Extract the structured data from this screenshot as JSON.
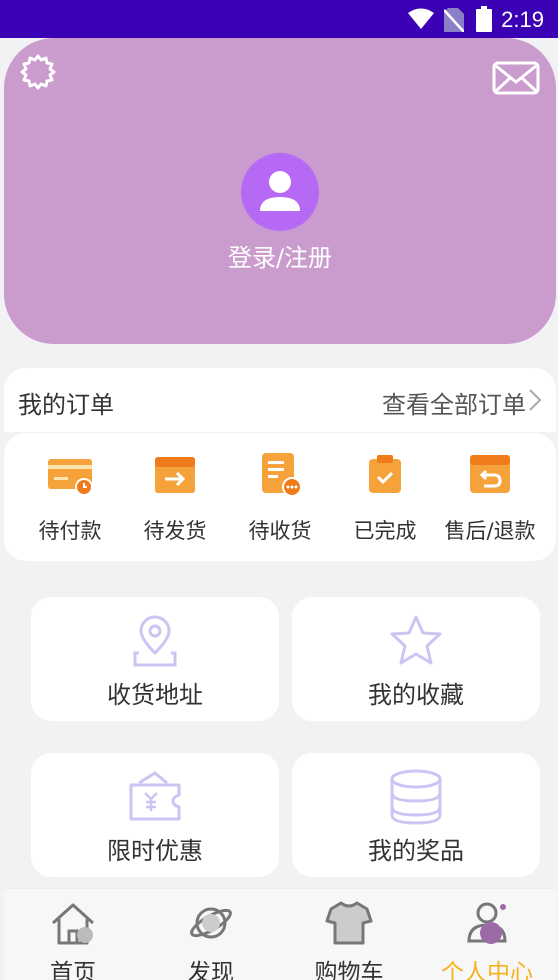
{
  "status_bar": {
    "time": "2:19"
  },
  "header": {
    "login_label": "登录/注册"
  },
  "orders": {
    "title": "我的订单",
    "view_all": "查看全部订单",
    "items": [
      {
        "label": "待付款",
        "icon": "wallet-card-icon"
      },
      {
        "label": "待发货",
        "icon": "box-arrow-icon"
      },
      {
        "label": "待收货",
        "icon": "receipt-icon"
      },
      {
        "label": "已完成",
        "icon": "clipboard-check-icon"
      },
      {
        "label": "售后/退款",
        "icon": "return-box-icon"
      }
    ]
  },
  "services": [
    {
      "label": "收货地址",
      "icon": "location-pin-icon"
    },
    {
      "label": "我的收藏",
      "icon": "star-icon"
    },
    {
      "label": "限时优惠",
      "icon": "coupon-icon"
    },
    {
      "label": "我的奖品",
      "icon": "coin-stack-icon"
    }
  ],
  "nav": [
    {
      "label": "首页",
      "icon": "home-icon"
    },
    {
      "label": "发现",
      "icon": "planet-icon"
    },
    {
      "label": "购物车",
      "icon": "shirt-icon"
    },
    {
      "label": "个人中心",
      "icon": "profile-icon",
      "active": true
    }
  ],
  "colors": {
    "status_bar": "#3a02b4",
    "header_bg": "#c99ccd",
    "avatar_bg": "#b569f5",
    "order_icon": "#f6a23a",
    "service_icon": "#c9c6f3",
    "nav_active": "#f6b21a"
  }
}
